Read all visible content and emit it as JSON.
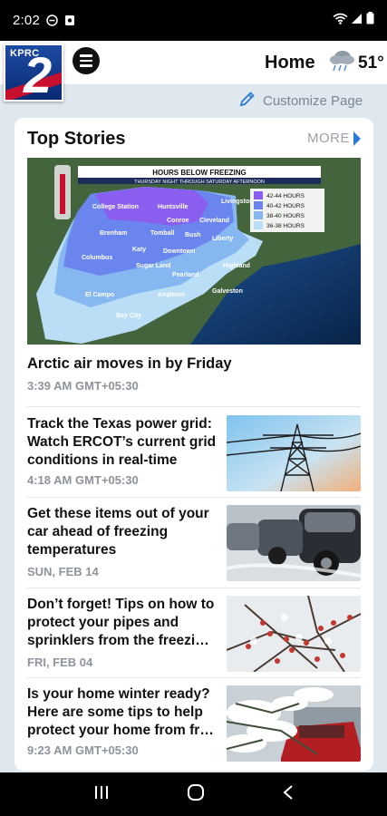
{
  "status_bar": {
    "time": "2:02",
    "icons": [
      "do-not-disturb-icon",
      "media-icon",
      "wifi-icon",
      "signal-icon",
      "battery-icon"
    ]
  },
  "header": {
    "logo_text": "KPRC 2",
    "menu_icon": "hamburger-menu-icon",
    "title": "Home",
    "weather_icon": "rain-cloud-icon",
    "temperature": "51°"
  },
  "customize": {
    "label": "Customize Page",
    "icon": "pencil-icon"
  },
  "top_stories": {
    "title": "Top Stories",
    "more_label": "MORE",
    "hero": {
      "image": {
        "banner_title": "HOURS BELOW FREEZING",
        "banner_subtitle": "THURSDAY NIGHT THROUGH SATURDAY AFTERNOON",
        "legend": [
          "42-44 HOURS",
          "40-42 HOURS",
          "38-40 HOURS",
          "36-38 HOURS"
        ],
        "cities": [
          "College Station",
          "Huntsville",
          "Livingston",
          "Conroe",
          "Cleveland",
          "Brenham",
          "Tomball",
          "Bush",
          "Liberty",
          "Katy",
          "Downtown",
          "Columbus",
          "Sugar Land",
          "Pearland",
          "Highland",
          "El Campo",
          "Angleton",
          "Galveston",
          "Bay City"
        ]
      },
      "headline": "Arctic air moves in by Friday",
      "time": "3:39 AM GMT+05:30"
    },
    "stories": [
      {
        "headline": "Track the Texas power grid: Watch ERCOT’s current grid conditions in real-time",
        "time": "4:18 AM GMT+05:30",
        "thumb": "power-tower-image"
      },
      {
        "headline": "Get these items out of your car ahead of freezing temperatures",
        "time": "SUN, FEB 14",
        "thumb": "frozen-cars-image"
      },
      {
        "headline": "Don’t forget! Tips on how to protect your pipes and sprinklers from the freezi…",
        "time": "FRI, FEB 04",
        "thumb": "icy-branches-image"
      },
      {
        "headline": "Is your home winter ready? Here are some tips to help protect your home from fr…",
        "time": "9:23 AM GMT+05:30",
        "thumb": "snowy-tree-image"
      }
    ]
  },
  "nav_bar": {
    "items": [
      "recent-apps-icon",
      "home-icon",
      "back-icon"
    ]
  }
}
